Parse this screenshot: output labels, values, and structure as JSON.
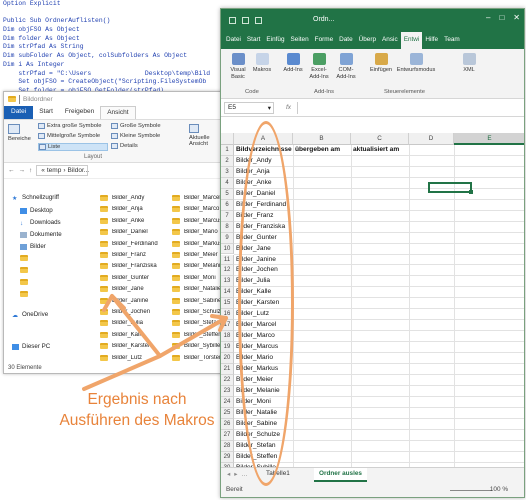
{
  "code": {
    "lines": [
      "Option Explicit",
      "",
      "Public Sub OrdnerAuflisten()",
      "Dim objFSO As Object",
      "Dim folder As Object",
      "Dim strPfad As String",
      "Dim subFolder As Object, colSubfolders As Object",
      "Dim i As Integer",
      "    strPfad = \"C:\\Users              Desktop\\temp\\Bild",
      "    Set objFSO = CreateObject(\"Scripting.FileSystemOb",
      "    Set folder = objFSO.GetFolder(strPfad)"
    ]
  },
  "explorer": {
    "title": "Bildordner",
    "tabs": [
      "Datei",
      "Start",
      "Freigeben",
      "Ansicht"
    ],
    "ribbon": {
      "panes": "Bereiche",
      "extra_large": "Extra große Symbole",
      "large": "Große Symbole",
      "medium": "Mittelgroße Symbole",
      "small": "Kleine Symbole",
      "list": "Liste",
      "details": "Details",
      "current_view": "Aktuelle Ansicht",
      "layout_group": "Layout"
    },
    "address": {
      "path1": "temp",
      "path2": "Bildor..."
    },
    "nav": {
      "quick_access": "Schnellzugriff",
      "desktop": "Desktop",
      "downloads": "Downloads",
      "documents": "Dokumente",
      "pictures": "Bilder",
      "onedrive": "OneDrive",
      "this_pc": "Dieser PC"
    },
    "folders_col1": [
      "Bilder_Andy",
      "Bilder_Anja",
      "Bilder_Anke",
      "Bilder_Daniel",
      "Bilder_Ferdinand",
      "Bilder_Franz",
      "Bilder_Franziska",
      "Bilder_Gunter",
      "Bilder_Jane",
      "Bilder_Janine",
      "Bilder_Jochen",
      "Bilder_Julia",
      "Bilder_Kalle",
      "Bilder_Karsten",
      "Bilder_Lutz"
    ],
    "folders_col2": [
      "Bilder_Marcel",
      "Bilder_Marco",
      "Bilder_Marcus",
      "Bilder_Mario",
      "Bilder_Markus",
      "Bilder_Meier",
      "Bilder_Melanie",
      "Bilder_Moni",
      "Bilder_Natalie",
      "Bilder_Sabine",
      "Bilder_Schulze",
      "Bilder_Stefan",
      "Bilder_Steffen",
      "Bilder_Sybille",
      "Bilder_Torsten"
    ],
    "status": "30 Elemente"
  },
  "excel": {
    "window_title": "Ordn...",
    "tabs": [
      "Datei",
      "Start",
      "Einfüg",
      "Seiten",
      "Forme",
      "Date",
      "Überp",
      "Ansic",
      "Entwi",
      "Hilfe",
      "Team"
    ],
    "active_tab": "Entwi",
    "ribbon": {
      "visual_basic": "Visual Basic",
      "macros": "Makros",
      "addins": "Add-Ins",
      "excel_addins": "Excel-Add-Ins",
      "com_addins": "COM-Add-Ins",
      "insert": "Einfügen",
      "design_mode": "Entwurfsmodus",
      "xml": "XML",
      "group_code": "Code",
      "group_addins": "Add-Ins",
      "group_controls": "Steuerelemente"
    },
    "name_box": "E5",
    "fx": "fx",
    "columns": [
      "A",
      "B",
      "C",
      "D",
      "E"
    ],
    "headers": [
      "Bildverzeichnisse",
      "übergeben am",
      "aktualisiert am"
    ],
    "rows": [
      "Bilder_Andy",
      "Bilder_Anja",
      "Bilder_Anke",
      "Bilder_Daniel",
      "Bilder_Ferdinand",
      "Bilder_Franz",
      "Bilder_Franziska",
      "Bilder_Gunter",
      "Bilder_Jane",
      "Bilder_Janine",
      "Bilder_Jochen",
      "Bilder_Julia",
      "Bilder_Kalle",
      "Bilder_Karsten",
      "Bilder_Lutz",
      "Bilder_Marcel",
      "Bilder_Marco",
      "Bilder_Marcus",
      "Bilder_Mario",
      "Bilder_Markus",
      "Bilder_Meier",
      "Bilder_Melanie",
      "Bilder_Moni",
      "Bilder_Natalie",
      "Bilder_Sabine",
      "Bilder_Schulze",
      "Bilder_Stefan",
      "Bilder_Steffen",
      "Bilder_Sybille",
      "Bilder_Torsten"
    ],
    "sheet1": "Tabelle1",
    "sheet2": "Ordner ausles",
    "status_ready": "Bereit",
    "zoom": "100 %"
  },
  "annotation": {
    "line1": "Ergebnis nach",
    "line2": "Ausführen des Makros"
  },
  "colors": {
    "excel_green": "#217346",
    "annotation": "#e8833a",
    "folder": "#f3c74a"
  }
}
